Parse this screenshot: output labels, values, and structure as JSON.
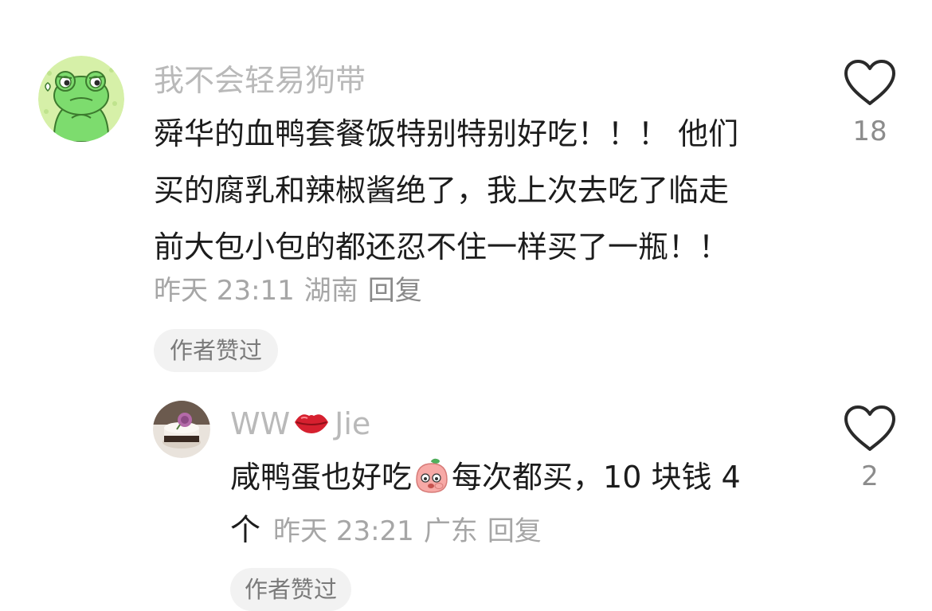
{
  "comments": [
    {
      "username": "我不会轻易狗带",
      "avatar_icon": "frog-avatar-icon",
      "body_lines": [
        "舜华的血鸭套餐饭特别特别好吃！！！ 他们",
        "买的腐乳和辣椒酱绝了，我上次去吃了临走",
        "前大包小包的都还忍不住一样买了一瓶！！"
      ],
      "time": "昨天 23:11",
      "location": "湖南",
      "reply_label": "回复",
      "badge": "作者赞过",
      "like_icon": "heart-outline-icon",
      "like_count": "18"
    },
    {
      "username_left": "WW",
      "username_icon": "kiss-lips-icon",
      "username_right": "Jie",
      "avatar_icon": "cake-avatar-icon",
      "body_before_emoji": "咸鸭蛋也好吃",
      "emoji_icon": "peach-face-emoji-icon",
      "body_after_emoji": "每次都买，10 块钱 4",
      "body_tail": "个",
      "time": "昨天 23:21",
      "location": "广东",
      "reply_label": "回复",
      "badge": "作者赞过",
      "like_icon": "heart-outline-icon",
      "like_count": "2"
    }
  ],
  "colors": {
    "username": "#b9b9b9",
    "meta": "#a6a6a6",
    "badge_bg": "#f2f2f2",
    "frog_green": "#7ddc6e",
    "avatar_bg": "#d6f0a8"
  }
}
